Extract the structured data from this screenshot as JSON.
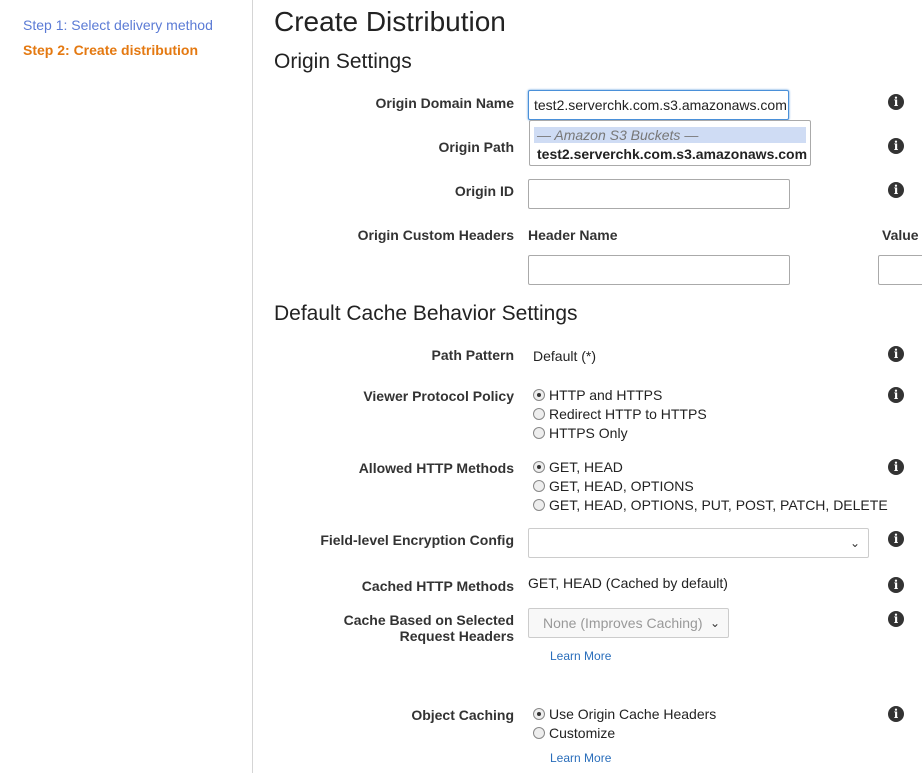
{
  "sidebar": {
    "steps": [
      {
        "label": "Step 1: Select delivery method"
      },
      {
        "label": "Step 2: Create distribution"
      }
    ]
  },
  "page": {
    "title": "Create Distribution"
  },
  "origin_settings": {
    "heading": "Origin Settings",
    "origin_domain_name": {
      "label": "Origin Domain Name",
      "value": "test2.serverchk.com.s3.amazonaws.com",
      "autocomplete": {
        "group": "— Amazon S3 Buckets —",
        "item": "test2.serverchk.com.s3.amazonaws.com"
      }
    },
    "origin_path": {
      "label": "Origin Path",
      "value": ""
    },
    "origin_id": {
      "label": "Origin ID",
      "value": ""
    },
    "custom_headers": {
      "label": "Origin Custom Headers",
      "header_name_col": "Header Name",
      "value_col": "Value"
    }
  },
  "cache_behavior": {
    "heading": "Default Cache Behavior Settings",
    "path_pattern": {
      "label": "Path Pattern",
      "value": "Default (*)"
    },
    "viewer_protocol": {
      "label": "Viewer Protocol Policy",
      "options": [
        "HTTP and HTTPS",
        "Redirect HTTP to HTTPS",
        "HTTPS Only"
      ],
      "selected": 0
    },
    "allowed_methods": {
      "label": "Allowed HTTP Methods",
      "options": [
        "GET, HEAD",
        "GET, HEAD, OPTIONS",
        "GET, HEAD, OPTIONS, PUT, POST, PATCH, DELETE"
      ],
      "selected": 0
    },
    "field_level_encryption": {
      "label": "Field-level Encryption Config",
      "value": ""
    },
    "cached_methods": {
      "label": "Cached HTTP Methods",
      "value": "GET, HEAD (Cached by default)"
    },
    "cache_headers": {
      "label_line1": "Cache Based on Selected",
      "label_line2": "Request Headers",
      "value": "None (Improves Caching)",
      "learn_more": "Learn More"
    },
    "object_caching": {
      "label": "Object Caching",
      "options": [
        "Use Origin Cache Headers",
        "Customize"
      ],
      "selected": 0,
      "learn_more": "Learn More"
    }
  },
  "icons": {
    "info": "i",
    "chevron": "⌄"
  }
}
